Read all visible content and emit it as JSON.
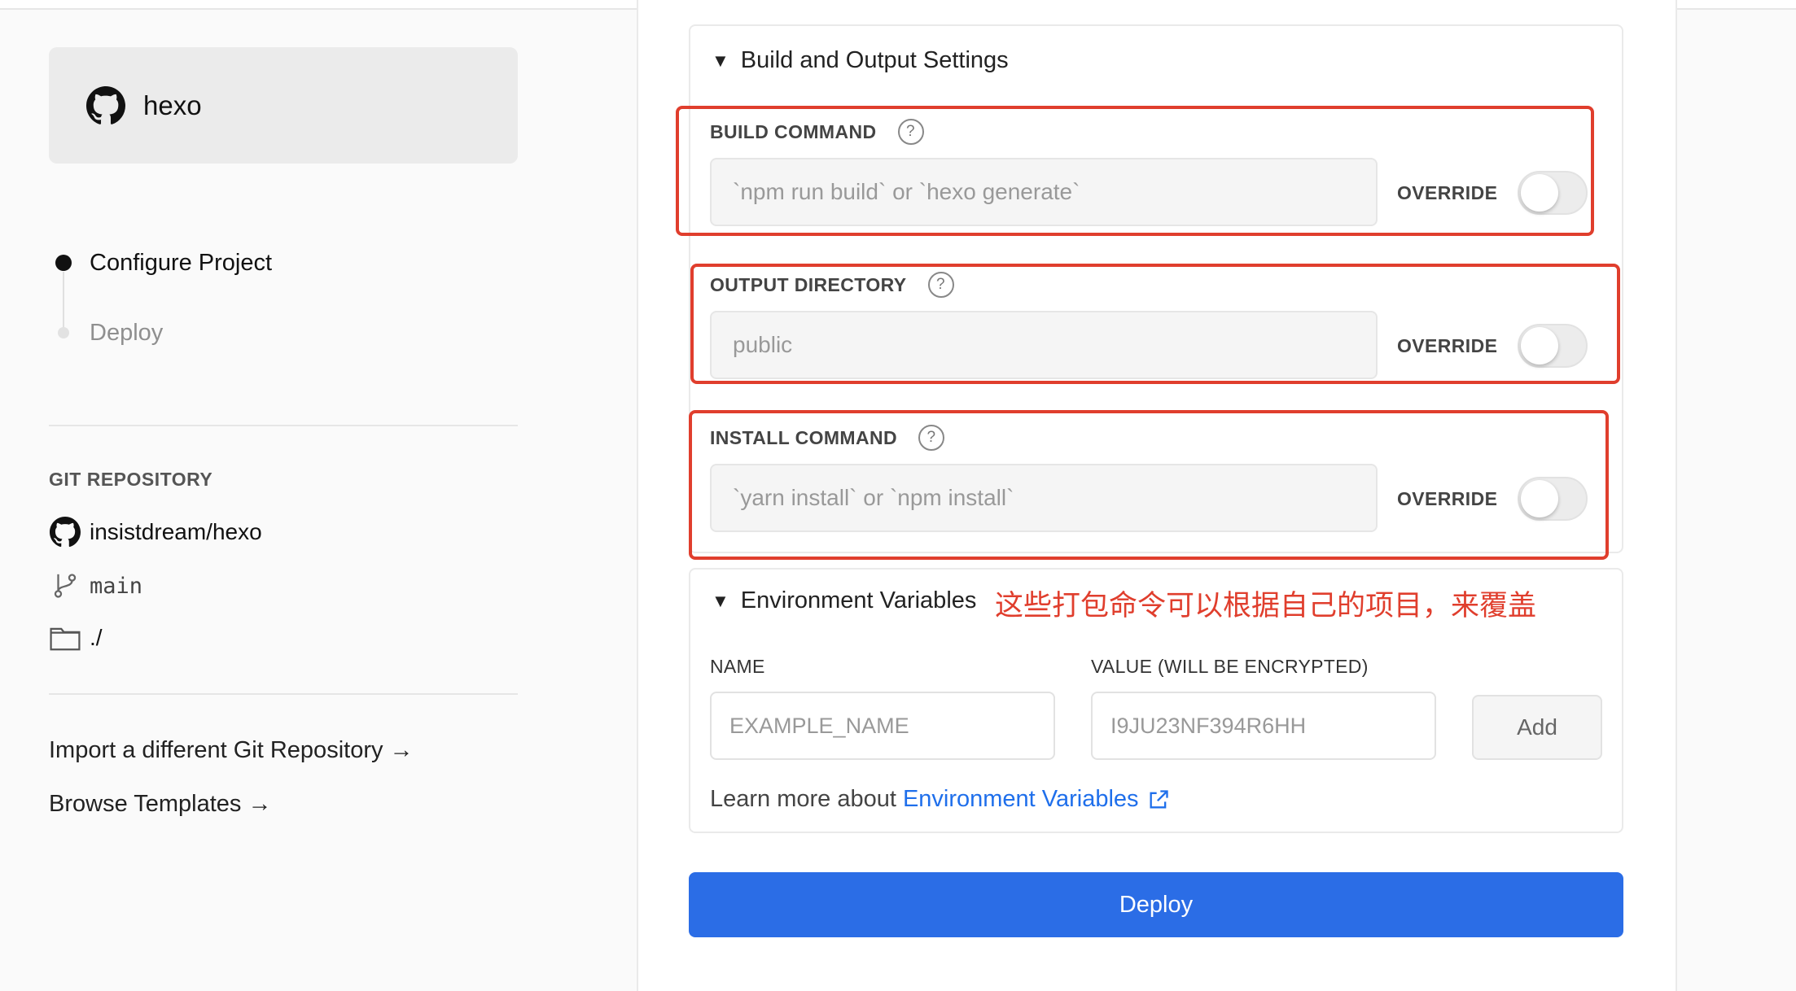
{
  "project": {
    "name": "hexo",
    "icon": "github-icon"
  },
  "steps": [
    {
      "label": "Configure Project",
      "state": "active"
    },
    {
      "label": "Deploy",
      "state": "pending"
    }
  ],
  "git": {
    "heading": "GIT REPOSITORY",
    "repo": "insistdream/hexo",
    "branch": "main",
    "directory": "./"
  },
  "links": {
    "import": "Import a different Git Repository →",
    "templates": "Browse Templates →"
  },
  "build_settings": {
    "title": "Build and Output Settings",
    "build": {
      "label": "BUILD COMMAND",
      "placeholder": "`npm run build` or `hexo generate`",
      "override_label": "OVERRIDE",
      "override": false
    },
    "output": {
      "label": "OUTPUT DIRECTORY",
      "placeholder": "public",
      "override_label": "OVERRIDE",
      "override": false
    },
    "install": {
      "label": "INSTALL COMMAND",
      "placeholder": "`yarn install` or `npm install`",
      "override_label": "OVERRIDE",
      "override": false
    }
  },
  "annotation": "这些打包命令可以根据自己的项目，来覆盖",
  "env": {
    "title": "Environment Variables",
    "name_label": "NAME",
    "value_label": "VALUE (WILL BE ENCRYPTED)",
    "name_placeholder": "EXAMPLE_NAME",
    "value_placeholder": "I9JU23NF394R6HH",
    "add_label": "Add",
    "learn_prefix": "Learn more about",
    "learn_link": "Environment Variables"
  },
  "deploy_label": "Deploy",
  "colors": {
    "accent": "#2b6de6",
    "annotation": "#e03e2d",
    "link": "#1f6feb"
  }
}
